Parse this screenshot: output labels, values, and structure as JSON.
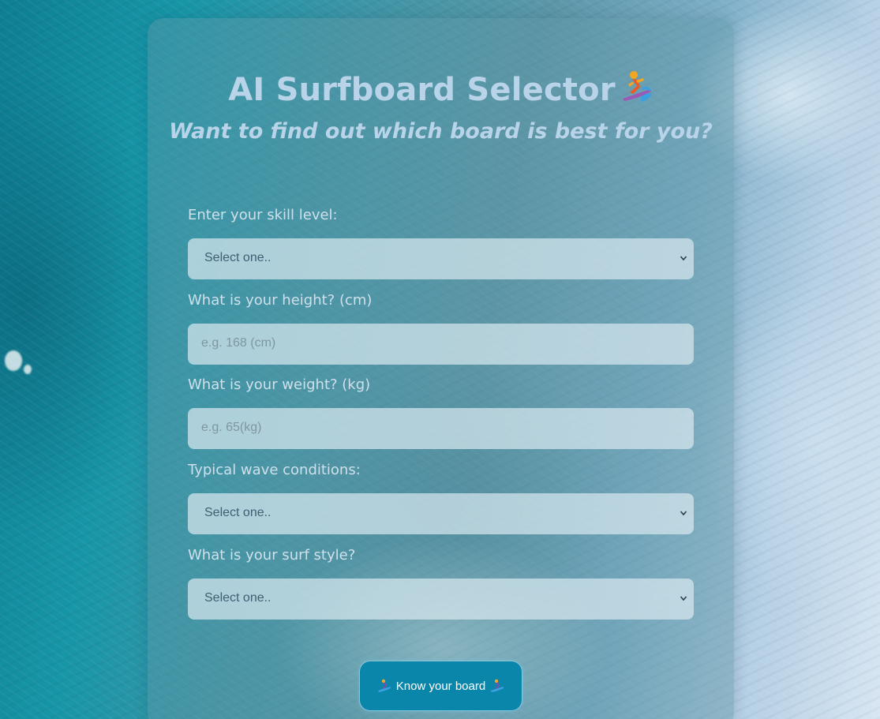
{
  "header": {
    "title": "AI Surfboard Selector",
    "title_icon": "surfer-icon",
    "subtitle": "Want to find out which board is best for you?"
  },
  "form": {
    "skill": {
      "label": "Enter your skill level:",
      "selected": "Select one.."
    },
    "height": {
      "label": "What is your height? (cm)",
      "placeholder": "e.g. 168 (cm)",
      "value": ""
    },
    "weight": {
      "label": "What is your weight? (kg)",
      "placeholder": "e.g. 65(kg)",
      "value": ""
    },
    "waves": {
      "label": "Typical wave conditions:",
      "selected": "Select one.."
    },
    "style": {
      "label": "What is your surf style?",
      "selected": "Select one.."
    }
  },
  "submit": {
    "label": "Know your board",
    "icon": "surfer-icon"
  },
  "colors": {
    "title": "#b9d3e8",
    "button": "#0b86ab",
    "field_bg": "#d7e8ee"
  }
}
